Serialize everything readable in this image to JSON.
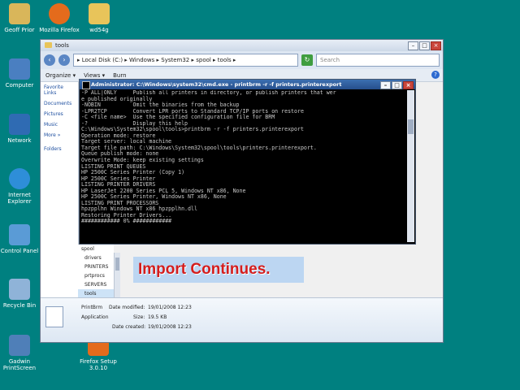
{
  "desktop": {
    "icons": [
      {
        "label": "Geoff Prior",
        "color": "#d9b65a"
      },
      {
        "label": "Mozilla Firefox",
        "color": "#e46b1c"
      },
      {
        "label": "wd54g",
        "color": "#e8c45a"
      },
      {
        "label": "Computer",
        "color": "#4a7fc1"
      },
      {
        "label": "Network",
        "color": "#2f6bb3"
      },
      {
        "label": "Internet Explorer",
        "color": "#2e8ed8"
      },
      {
        "label": "Control Panel",
        "color": "#5a9bd6"
      },
      {
        "label": "Recycle Bin",
        "color": "#8fb3d8"
      },
      {
        "label": "Gadwin PrintScreen",
        "color": "#4f7fb8"
      },
      {
        "label": "Firefox Setup 3.0.10",
        "color": "#e46b1c"
      }
    ]
  },
  "explorer": {
    "title": "tools",
    "address": "▸ Local Disk (C:) ▸ Windows ▸ System32 ▸ spool ▸ tools ▸",
    "search_placeholder": "Search",
    "toolbar": {
      "organize": "Organize ▾",
      "views": "Views ▾",
      "burn": "Burn"
    },
    "nav": {
      "favorite_links": "Favorite Links",
      "documents": "Documents",
      "pictures": "Pictures",
      "music": "Music",
      "more": "More »",
      "folders": "Folders"
    },
    "tree": [
      "spool",
      "drivers",
      "PRINTERS",
      "prtprocs",
      "SERVERS",
      "tools"
    ],
    "details": {
      "name": "PrintBrm",
      "type": "Application",
      "modified_label": "Date modified:",
      "modified": "19/01/2008 12:23",
      "size_label": "Size:",
      "size": "19.5 KB",
      "created_label": "Date created:",
      "created": "19/01/2008 12:23"
    }
  },
  "cmd": {
    "title": "Administrator: C:\\Windows\\system32\\cmd.exe - printbrm -r -f printers.printerexport",
    "lines": [
      "-P ALL|ONLY     Publish all printers in directory, or publish printers that wer",
      "e published originally",
      "-NOBIN          Omit the binaries from the backup",
      "-LPR2TCP        Convert LPR ports to Standard TCP/IP ports on restore",
      "-C <file name>  Use the specified configuration file for BRM",
      "-?              Display this help",
      "",
      "C:\\Windows\\System32\\spool\\tools>printbrm -r -f printers.printerexport",
      "Operation mode: restore",
      "Target server: local machine",
      "Target file path: C:\\Windows\\System32\\spool\\tools\\printers.printerexport.",
      "Queue publish mode: none",
      "Overwrite Mode: keep existing settings",
      "",
      "LISTING PRINT QUEUES",
      "HP 2500C Series Printer (Copy 1)",
      "HP 2500C Series Printer",
      "LISTING PRINTER DRIVERS",
      "HP LaserJet 2200 Series PCL 5, Windows NT x86, None",
      "HP 2500C Series Printer, Windows NT x86, None",
      "LISTING PRINT PROCESSORS",
      "hpzpplhn Windows NT x86 hpzpplhn.dll",
      "",
      "Restoring Printer Drivers...",
      "############ 0% ############"
    ]
  },
  "annotation": "Import Continues."
}
